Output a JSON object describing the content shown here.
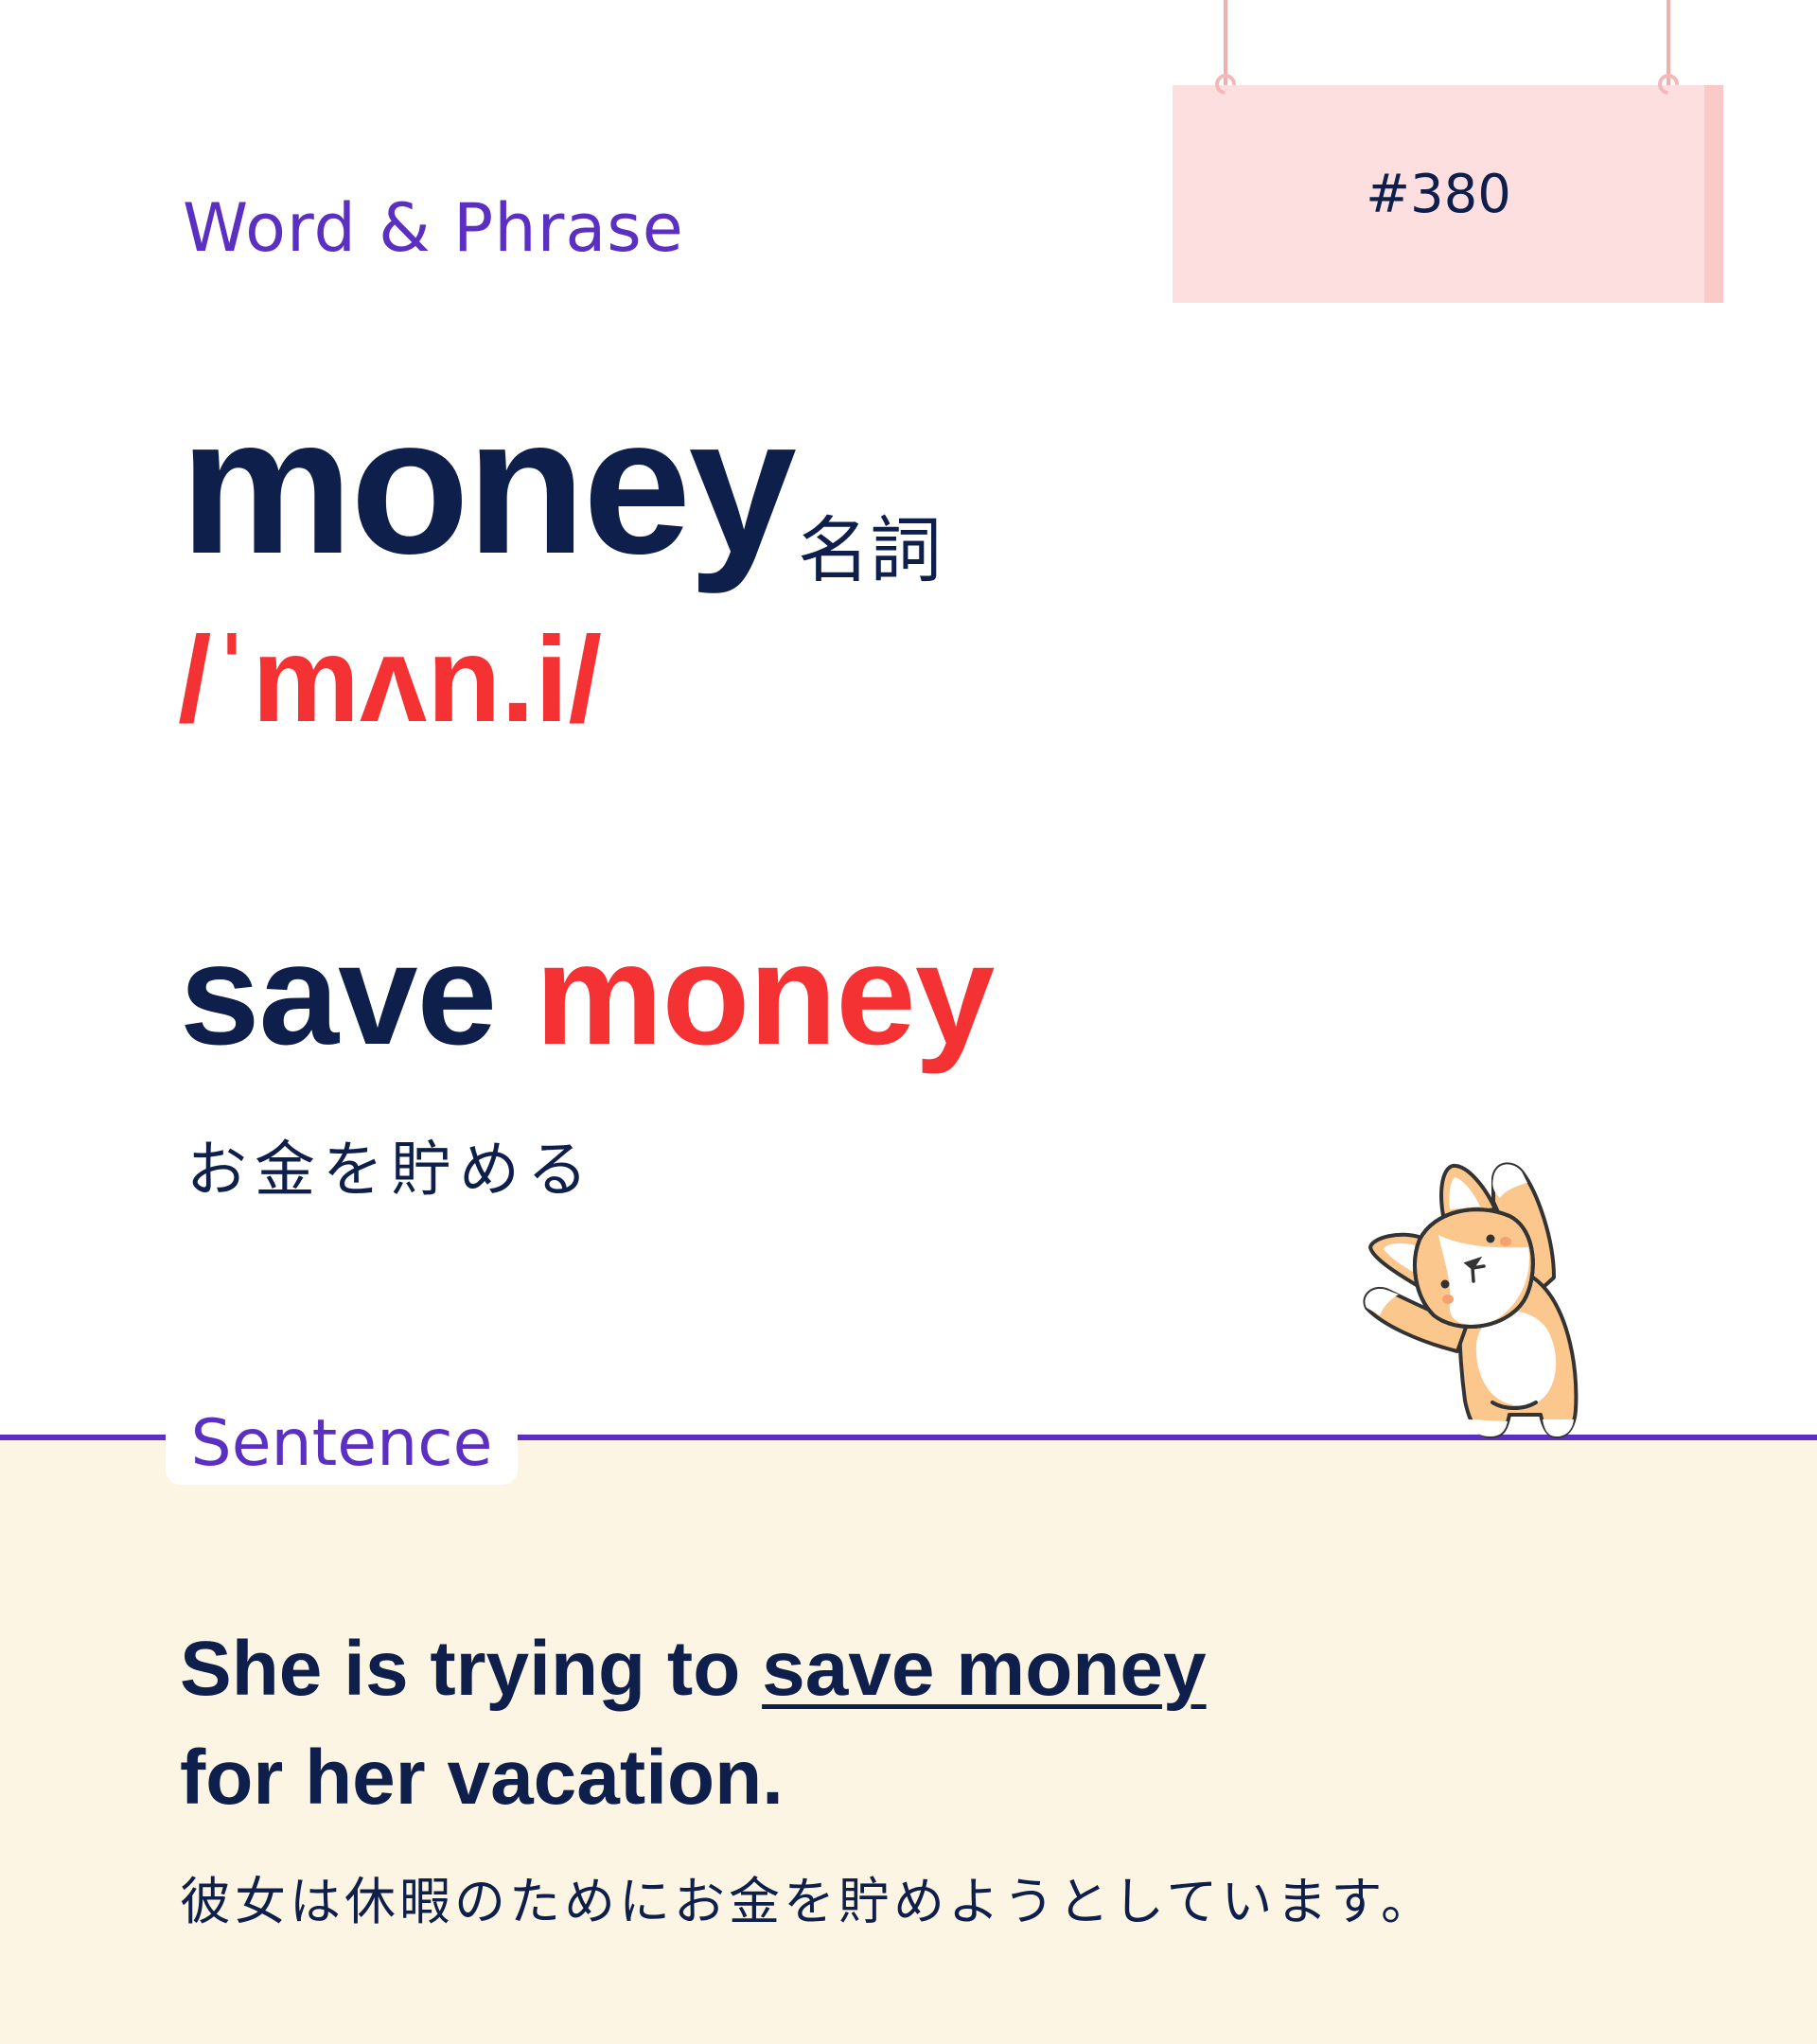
{
  "header": {
    "category": "Word & Phrase",
    "card_number": "#380"
  },
  "entry": {
    "word": "money",
    "part_of_speech": "名詞",
    "pronunciation": "/ˈmʌn.i/",
    "phrase_prefix": "save",
    "phrase_keyword": "money",
    "phrase_translation": "お金を貯める"
  },
  "sentence": {
    "label": "Sentence",
    "line1_prefix": "She is trying to ",
    "line1_highlight": "save money",
    "line2": "for her vacation.",
    "translation": "彼女は休暇のためにお金を貯めようとしています。"
  },
  "colors": {
    "navy": "#0d1f4a",
    "red": "#f53233",
    "purple": "#5b2fc2",
    "sign_pink": "#fddfe0",
    "cream": "#fdf5e3"
  },
  "icons": {
    "mascot": "corgi-mascot-icon"
  }
}
